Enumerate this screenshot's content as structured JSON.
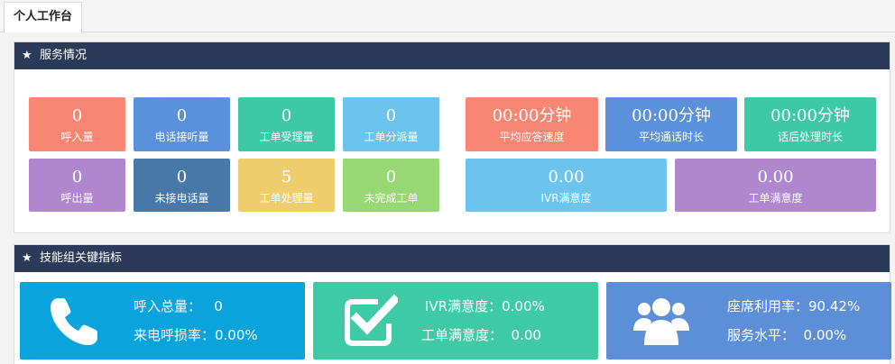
{
  "tab": {
    "label": "个人工作台"
  },
  "service": {
    "title": "服务情况",
    "tiles": [
      {
        "value": "0",
        "label": "呼入量"
      },
      {
        "value": "0",
        "label": "电话接听量"
      },
      {
        "value": "0",
        "label": "工单受理量"
      },
      {
        "value": "0",
        "label": "工单分派量"
      },
      {
        "value": "00:00分钟",
        "label": "平均应答速度"
      },
      {
        "value": "00:00分钟",
        "label": "平均通话时长"
      },
      {
        "value": "00:00分钟",
        "label": "话后处理时长"
      },
      {
        "value": "0",
        "label": "呼出量"
      },
      {
        "value": "0",
        "label": "未接电话量"
      },
      {
        "value": "5",
        "label": "工单处理量"
      },
      {
        "value": "0",
        "label": "未完成工单"
      },
      {
        "value": "0.00",
        "label": "IVR满意度"
      },
      {
        "value": "0.00",
        "label": "工单满意度"
      }
    ]
  },
  "kpi": {
    "title": "技能组关键指标",
    "cards": [
      {
        "line1": "呼入总量：   0",
        "line2": "来电呼损率：0.00%",
        "color": "#0aa3dc",
        "icon": "phone-icon"
      },
      {
        "line1": "IVR满意度：0.00%",
        "line2": "工单满意度：  0.00",
        "color": "#3dcaa5",
        "icon": "checkbox-icon"
      },
      {
        "line1": "座席利用率：90.42%",
        "line2": "服务水平：  0.00%",
        "color": "#5c8fd8",
        "icon": "users-icon"
      }
    ]
  }
}
